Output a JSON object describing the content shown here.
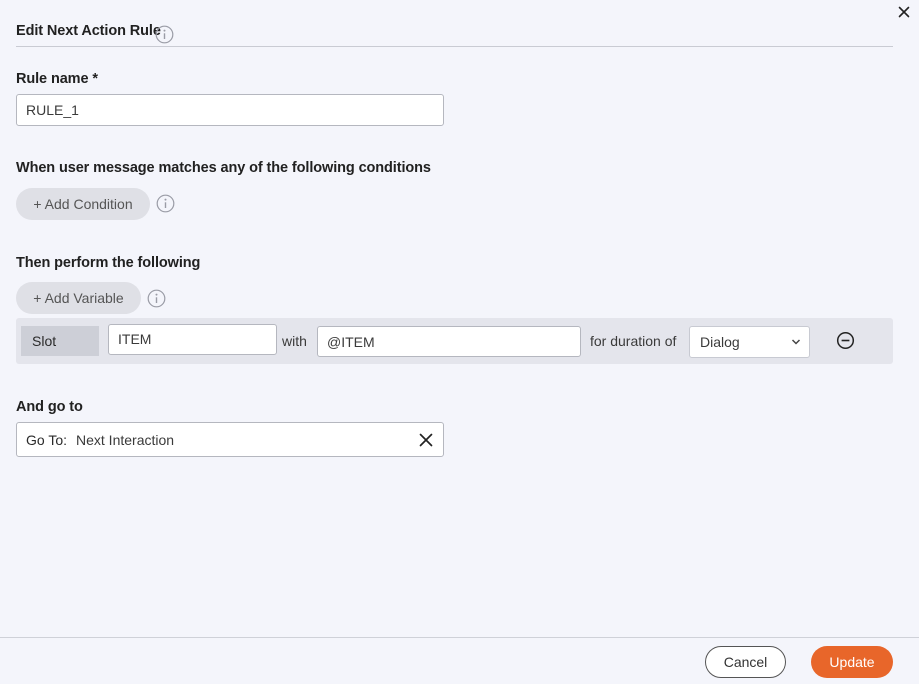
{
  "dialog": {
    "title": "Edit Next Action Rule",
    "close_icon": "close-icon"
  },
  "rule_name": {
    "label": "Rule name *",
    "value": "RULE_1"
  },
  "conditions": {
    "label": "When user message matches any of the following conditions",
    "add_button": "+ Add Condition"
  },
  "actions": {
    "label": "Then perform the following",
    "add_button": "+ Add Variable",
    "rows": [
      {
        "type": "Slot",
        "name": "ITEM",
        "with_label": "with",
        "value": "@ITEM",
        "duration_label": "for duration of",
        "duration": "Dialog"
      }
    ]
  },
  "goto": {
    "label": "And go to",
    "prefix": "Go To:",
    "value": "Next Interaction"
  },
  "footer": {
    "cancel": "Cancel",
    "update": "Update"
  },
  "colors": {
    "accent": "#e8662a",
    "background": "#f4f5fb"
  }
}
